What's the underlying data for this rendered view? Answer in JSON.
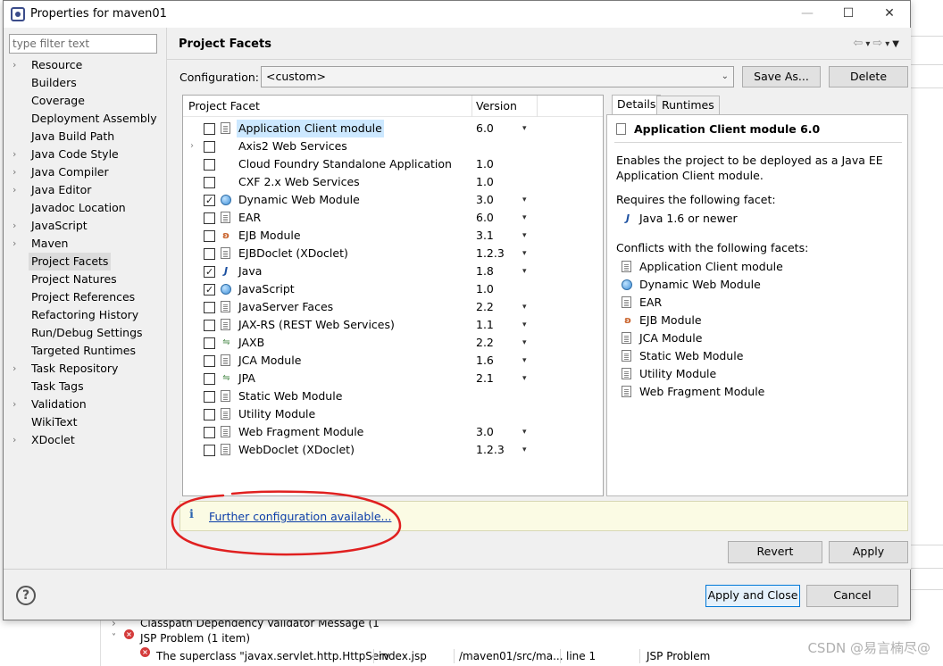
{
  "window": {
    "title": "Properties for maven01"
  },
  "filter": {
    "placeholder": "type filter text"
  },
  "sidebar": {
    "items": [
      {
        "label": "Resource",
        "expandable": true
      },
      {
        "label": "Builders",
        "expandable": false
      },
      {
        "label": "Coverage",
        "expandable": false
      },
      {
        "label": "Deployment Assembly",
        "expandable": false
      },
      {
        "label": "Java Build Path",
        "expandable": false
      },
      {
        "label": "Java Code Style",
        "expandable": true
      },
      {
        "label": "Java Compiler",
        "expandable": true
      },
      {
        "label": "Java Editor",
        "expandable": true
      },
      {
        "label": "Javadoc Location",
        "expandable": false
      },
      {
        "label": "JavaScript",
        "expandable": true
      },
      {
        "label": "Maven",
        "expandable": true
      },
      {
        "label": "Project Facets",
        "expandable": false,
        "selected": true
      },
      {
        "label": "Project Natures",
        "expandable": false
      },
      {
        "label": "Project References",
        "expandable": false
      },
      {
        "label": "Refactoring History",
        "expandable": false
      },
      {
        "label": "Run/Debug Settings",
        "expandable": false
      },
      {
        "label": "Targeted Runtimes",
        "expandable": false
      },
      {
        "label": "Task Repository",
        "expandable": true
      },
      {
        "label": "Task Tags",
        "expandable": false
      },
      {
        "label": "Validation",
        "expandable": true
      },
      {
        "label": "WikiText",
        "expandable": false
      },
      {
        "label": "XDoclet",
        "expandable": true
      }
    ]
  },
  "page": {
    "title": "Project Facets",
    "configuration_label": "Configuration:",
    "configuration_value": "<custom>",
    "save_as": "Save As...",
    "delete": "Delete"
  },
  "facets": {
    "col_facet": "Project Facet",
    "col_version": "Version",
    "rows": [
      {
        "name": "Application Client module",
        "version": "6.0",
        "checked": false,
        "icon": "doc",
        "dropdown": true,
        "selected": true
      },
      {
        "name": "Axis2 Web Services",
        "version": "",
        "checked": false,
        "icon": "none",
        "dropdown": false,
        "expandable": true
      },
      {
        "name": "Cloud Foundry Standalone Application",
        "version": "1.0",
        "checked": false,
        "icon": "none",
        "dropdown": false
      },
      {
        "name": "CXF 2.x Web Services",
        "version": "1.0",
        "checked": false,
        "icon": "none",
        "dropdown": false
      },
      {
        "name": "Dynamic Web Module",
        "version": "3.0",
        "checked": true,
        "icon": "globe",
        "dropdown": true
      },
      {
        "name": "EAR",
        "version": "6.0",
        "checked": false,
        "icon": "doc",
        "dropdown": true
      },
      {
        "name": "EJB Module",
        "version": "3.1",
        "checked": false,
        "icon": "bean",
        "dropdown": true
      },
      {
        "name": "EJBDoclet (XDoclet)",
        "version": "1.2.3",
        "checked": false,
        "icon": "doc",
        "dropdown": true
      },
      {
        "name": "Java",
        "version": "1.8",
        "checked": true,
        "icon": "java",
        "dropdown": true
      },
      {
        "name": "JavaScript",
        "version": "1.0",
        "checked": true,
        "icon": "globe",
        "dropdown": false
      },
      {
        "name": "JavaServer Faces",
        "version": "2.2",
        "checked": false,
        "icon": "doc",
        "dropdown": true
      },
      {
        "name": "JAX-RS (REST Web Services)",
        "version": "1.1",
        "checked": false,
        "icon": "doc",
        "dropdown": true
      },
      {
        "name": "JAXB",
        "version": "2.2",
        "checked": false,
        "icon": "xml",
        "dropdown": true
      },
      {
        "name": "JCA Module",
        "version": "1.6",
        "checked": false,
        "icon": "doc",
        "dropdown": true
      },
      {
        "name": "JPA",
        "version": "2.1",
        "checked": false,
        "icon": "xml",
        "dropdown": true
      },
      {
        "name": "Static Web Module",
        "version": "",
        "checked": false,
        "icon": "doc",
        "dropdown": false
      },
      {
        "name": "Utility Module",
        "version": "",
        "checked": false,
        "icon": "doc",
        "dropdown": false
      },
      {
        "name": "Web Fragment Module",
        "version": "3.0",
        "checked": false,
        "icon": "doc",
        "dropdown": true
      },
      {
        "name": "WebDoclet (XDoclet)",
        "version": "1.2.3",
        "checked": false,
        "icon": "doc",
        "dropdown": true
      }
    ]
  },
  "details": {
    "tab_details": "Details",
    "tab_runtimes": "Runtimes",
    "title": "Application Client module 6.0",
    "description_1": "Enables the project to be deployed as a Java EE",
    "description_2": "Application Client module.",
    "requires_label": "Requires the following facet:",
    "requires": [
      {
        "label": "Java 1.6 or newer",
        "icon": "java"
      }
    ],
    "conflicts_label": "Conflicts with the following facets:",
    "conflicts": [
      {
        "label": "Application Client module",
        "icon": "doc"
      },
      {
        "label": "Dynamic Web Module",
        "icon": "globe"
      },
      {
        "label": "EAR",
        "icon": "doc"
      },
      {
        "label": "EJB Module",
        "icon": "bean"
      },
      {
        "label": "JCA Module",
        "icon": "doc"
      },
      {
        "label": "Static Web Module",
        "icon": "doc"
      },
      {
        "label": "Utility Module",
        "icon": "doc"
      },
      {
        "label": "Web Fragment Module",
        "icon": "doc"
      }
    ]
  },
  "info": {
    "icon": "info-icon",
    "link": "Further configuration available..."
  },
  "buttons": {
    "revert": "Revert",
    "apply": "Apply",
    "apply_close": "Apply and Close",
    "cancel": "Cancel"
  },
  "background": {
    "row1": "Classpath Dependency Validator Message (1",
    "row2": "JSP Problem (1 item)",
    "row3_desc": "The superclass \"javax.servlet.http.HttpServ",
    "row3_resource": "index.jsp",
    "row3_path": "/maven01/src/ma...",
    "row3_location": "line 1",
    "row3_type": "JSP Problem",
    "watermark": "CSDN @易言楠尽@"
  },
  "colors": {
    "selection": "#cce8ff",
    "link": "#0b3da8",
    "annotation": "#e02020"
  }
}
